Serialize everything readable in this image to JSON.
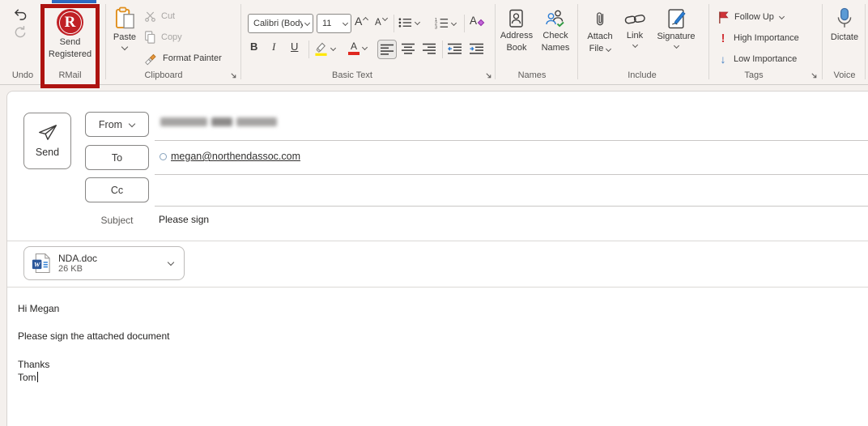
{
  "ribbon": {
    "undo_group": {
      "label": "Undo"
    },
    "rmail_group": {
      "label": "RMail",
      "logo_letter": "R",
      "send_registered_line1": "Send",
      "send_registered_line2": "Registered"
    },
    "clipboard_group": {
      "label": "Clipboard",
      "paste": "Paste",
      "cut": "Cut",
      "copy": "Copy",
      "format_painter": "Format Painter"
    },
    "basic_text_group": {
      "label": "Basic Text",
      "font_name": "Calibri (Body",
      "font_size": "11",
      "grow_font": "A",
      "shrink_font": "A",
      "clear_formatting": "A",
      "bold": "B",
      "italic": "I",
      "underline": "U",
      "font_color": "A"
    },
    "names_group": {
      "label": "Names",
      "address_book_line1": "Address",
      "address_book_line2": "Book",
      "check_names_line1": "Check",
      "check_names_line2": "Names"
    },
    "include_group": {
      "label": "Include",
      "attach_file_line1": "Attach",
      "attach_file_line2": "File",
      "link": "Link",
      "signature": "Signature"
    },
    "tags_group": {
      "label": "Tags",
      "follow_up": "Follow Up",
      "high_importance": "High Importance",
      "low_importance": "Low Importance",
      "high_importance_glyph": "!",
      "low_importance_glyph": "↓"
    },
    "voice_group": {
      "label": "Voice",
      "dictate": "Dictate"
    }
  },
  "compose": {
    "send_button": "Send",
    "from_button": "From",
    "to_button": "To",
    "cc_button": "Cc",
    "subject_label": "Subject",
    "subject_value": "Please sign",
    "to_recipient": "megan@northendassoc.com"
  },
  "attachment": {
    "filename": "NDA.doc",
    "filesize": "26 KB",
    "word_letter": "W"
  },
  "body": {
    "line1": "Hi Megan",
    "line2": "Please sign the attached document",
    "line3": "Thanks",
    "line4": "Tom"
  },
  "colors": {
    "highlight_box_red": "#ad1310",
    "rmail_logo_red": "#c02025",
    "active_tab_blue": "#2e6bc2",
    "highlight_yellow": "#ffe70a",
    "font_color_red": "#e0281f",
    "flag_red": "#d13438",
    "low_importance_blue": "#3f7dc2",
    "mic_blue": "#5b9bd5"
  }
}
